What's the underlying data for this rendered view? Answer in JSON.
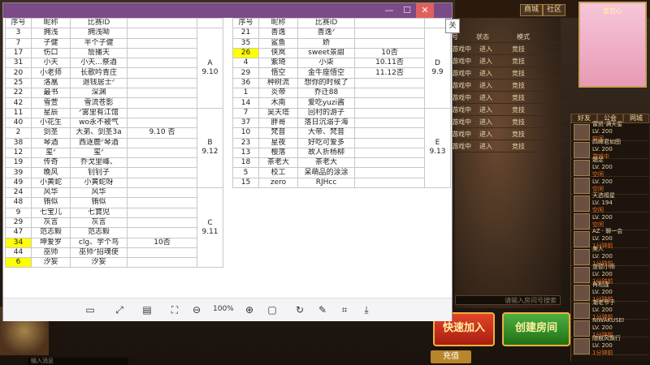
{
  "game": {
    "top_buttons": [
      "商城",
      "社区"
    ],
    "avatar_name": "皇宫心",
    "list_header": [
      "号",
      "状态",
      "模式"
    ],
    "list_rows": [
      {
        "status": "游戏中",
        "enter": "进入",
        "mode": "竞技"
      },
      {
        "status": "游戏中",
        "enter": "进入",
        "mode": "竞技"
      },
      {
        "status": "游戏中",
        "enter": "进入",
        "mode": "竞技"
      },
      {
        "status": "游戏中",
        "enter": "进入",
        "mode": "竞技"
      },
      {
        "status": "游戏中",
        "enter": "进入",
        "mode": "竞技"
      },
      {
        "status": "游戏中",
        "enter": "进入",
        "mode": "竞技"
      },
      {
        "status": "游戏中",
        "enter": "进入",
        "mode": "竞技"
      },
      {
        "status": "游戏中",
        "enter": "进入",
        "mode": "竞技"
      },
      {
        "status": "游戏中",
        "enter": "进入",
        "mode": "竞技"
      }
    ],
    "friend_tabs": [
      "好友",
      "公会",
      "网城"
    ],
    "friends": [
      {
        "name": "雷凯·满天星",
        "level": "LV. 200",
        "status": "空闲"
      },
      {
        "name": "四峰君如图",
        "level": "LV. 200",
        "status": "游戏中"
      },
      {
        "name": "翘足",
        "level": "LV. 200",
        "status": "空闲"
      },
      {
        "name": "",
        "level": "LV. 200",
        "status": "空闲"
      },
      {
        "name": "天选福星",
        "level": "LV. 194",
        "status": "空闲"
      },
      {
        "name": "",
        "level": "LV. 200",
        "status": "空闲"
      },
      {
        "name": "AZ · 聊一会",
        "level": "LV. 200",
        "status": "1分钟前"
      },
      {
        "name": "美人",
        "level": "LV. 200",
        "status": "1分钟前"
      },
      {
        "name": "道德小师",
        "level": "LV. 200",
        "status": "1分钟前"
      },
      {
        "name": "再相逢",
        "level": "LV. 200",
        "status": "1分钟前"
      },
      {
        "name": "潮老爷子",
        "level": "LV. 200",
        "status": "1分钟前"
      },
      {
        "name": "NIWAKUSEI",
        "level": "LV. 200",
        "status": "1分钟前"
      },
      {
        "name": "随痕风飘行",
        "level": "LV. 200",
        "status": "1分钟前"
      }
    ],
    "room_input_placeholder": "请输入房间号搜索",
    "quick_join": "快速加入",
    "create_room": "创建房间",
    "recharge": "充值",
    "chat_placeholder": "输入消息"
  },
  "viewer": {
    "window_controls": [
      "—",
      "☐",
      "✕"
    ],
    "zoom": "100%",
    "tooltip": "关"
  },
  "left_table": {
    "headers": [
      "序号",
      "昵称",
      "比赛ID"
    ],
    "groups": [
      {
        "label": "A",
        "date": "9.10",
        "rows": [
          {
            "no": "3",
            "name": "拥浅",
            "id": "拥浅呦",
            "note": ""
          },
          {
            "no": "7",
            "name": "子健",
            "id": "半个子健",
            "note": ""
          },
          {
            "no": "17",
            "name": "伤口",
            "id": "詹播天",
            "note": ""
          },
          {
            "no": "31",
            "name": "小天",
            "id": "小天...祭酒",
            "note": ""
          },
          {
            "no": "20",
            "name": "小老师",
            "id": "长歌吟青庄",
            "note": ""
          },
          {
            "no": "25",
            "name": "洛凰",
            "id": "退钱居士ᐟ",
            "note": ""
          },
          {
            "no": "22",
            "name": "最书",
            "id": "深渊",
            "note": ""
          },
          {
            "no": "42",
            "name": "雪萱",
            "id": "雪流苍影",
            "note": ""
          }
        ]
      },
      {
        "label": "B",
        "date": "9.12",
        "rows": [
          {
            "no": "11",
            "name": "星辰",
            "id": "ᐟ雾里有江馆",
            "note": ""
          },
          {
            "no": "40",
            "name": "小花生",
            "id": "wo永不被气",
            "note": ""
          },
          {
            "no": "2",
            "name": "剑圣",
            "id": "大弟、剑圣3a",
            "note": "9.10 否"
          },
          {
            "no": "38",
            "name": "琴酒",
            "id": "西逐鹿ᐟ琴酒",
            "note": ""
          },
          {
            "no": "12",
            "name": "玺ᐟ",
            "id": "玺ᐟ",
            "note": ""
          },
          {
            "no": "19",
            "name": "传奇",
            "id": "乔戈里峰、",
            "note": ""
          },
          {
            "no": "39",
            "name": "晚风",
            "id": "钊钊子",
            "note": ""
          },
          {
            "no": "49",
            "name": "小黄蛇",
            "id": "小黄蛇呀",
            "note": ""
          }
        ]
      },
      {
        "label": "C",
        "date": "9.11",
        "rows": [
          {
            "no": "24",
            "name": "风华",
            "id": "风华",
            "note": ""
          },
          {
            "no": "48",
            "name": "铕似",
            "id": "铕似",
            "note": ""
          },
          {
            "no": "9",
            "name": "七宝儿",
            "id": "七寶児",
            "note": ""
          },
          {
            "no": "29",
            "name": "灰言",
            "id": "灰言",
            "note": ""
          },
          {
            "no": "47",
            "name": "范志毅",
            "id": "范志毅",
            "note": ""
          },
          {
            "no": "34",
            "name": "坤爱罗",
            "id": "clg、学个鸟",
            "note": "10否",
            "yellow": true
          },
          {
            "no": "44",
            "name": "巫师",
            "id": "巫师ᐟ招魂使",
            "note": ""
          },
          {
            "no": "6",
            "name": "汐妄",
            "id": "汐妄",
            "note": "",
            "yellow": true
          }
        ]
      }
    ]
  },
  "right_table": {
    "headers": [
      "序号",
      "昵称",
      "比赛ID"
    ],
    "groups": [
      {
        "label": "D",
        "date": "9.9",
        "rows": [
          {
            "no": "21",
            "name": "善逸",
            "id": "善逸ᐟ",
            "note": ""
          },
          {
            "no": "35",
            "name": "鲨鱼",
            "id": "娇",
            "note": ""
          },
          {
            "no": "26",
            "name": "侠岚",
            "id": "sweet景甜",
            "note": "10否",
            "yellow": true
          },
          {
            "no": "4",
            "name": "紫琦",
            "id": "小柒",
            "note": "10.11否"
          },
          {
            "no": "29",
            "name": "悟空",
            "id": "金牛座悟空",
            "note": "11.12否"
          },
          {
            "no": "36",
            "name": "种树流",
            "id": "想你的时候了",
            "note": ""
          },
          {
            "no": "1",
            "name": "炎帝",
            "id": "乔迁88",
            "note": ""
          },
          {
            "no": "14",
            "name": "木南",
            "id": "爱吃yuzi酱",
            "note": ""
          }
        ]
      },
      {
        "label": "E",
        "date": "9.13",
        "rows": [
          {
            "no": "7",
            "name": "吴天塔",
            "id": "回村的游子",
            "note": ""
          },
          {
            "no": "37",
            "name": "胖哥",
            "id": "落日沉溺于海",
            "note": ""
          },
          {
            "no": "10",
            "name": "梵音",
            "id": "大帝、梵音",
            "note": ""
          },
          {
            "no": "23",
            "name": "星夜",
            "id": "好吃可爱多",
            "note": ""
          },
          {
            "no": "13",
            "name": "樱落",
            "id": "故人折杨柳",
            "note": ""
          },
          {
            "no": "18",
            "name": "茶老大",
            "id": "茶老大",
            "note": ""
          },
          {
            "no": "5",
            "name": "校工",
            "id": "呆萌品的涂涂",
            "note": ""
          },
          {
            "no": "15",
            "name": "zero",
            "id": "RJHcc",
            "note": ""
          }
        ]
      }
    ]
  }
}
